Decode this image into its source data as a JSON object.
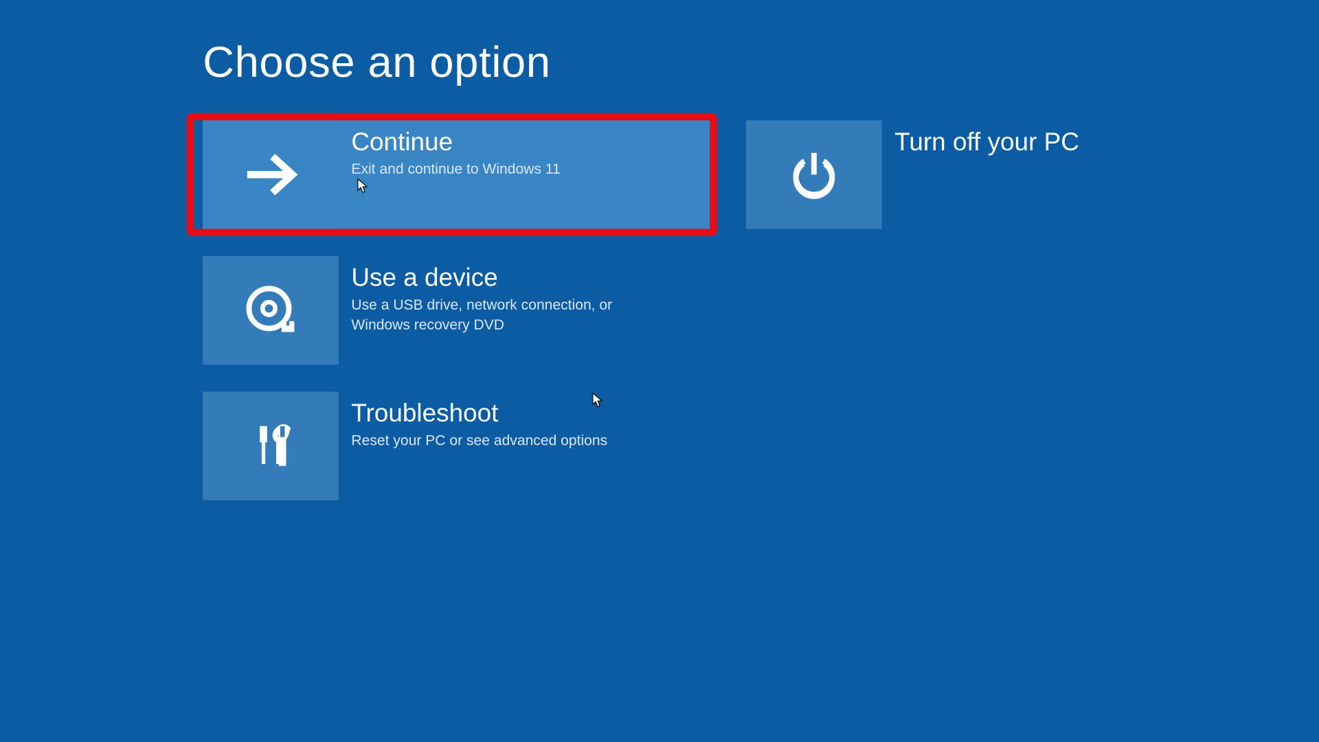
{
  "title": "Choose an option",
  "highlighted_option": "continue",
  "left_column": [
    {
      "id": "continue",
      "title": "Continue",
      "description": "Exit and continue to Windows 11",
      "icon": "arrow-right-icon",
      "selected": true
    },
    {
      "id": "use-a-device",
      "title": "Use a device",
      "description": "Use a USB drive, network connection, or Windows recovery DVD",
      "icon": "disc-icon",
      "selected": false
    },
    {
      "id": "troubleshoot",
      "title": "Troubleshoot",
      "description": "Reset your PC or see advanced options",
      "icon": "tools-icon",
      "selected": false
    }
  ],
  "right_column": [
    {
      "id": "turn-off",
      "title": "Turn off your PC",
      "description": "",
      "icon": "power-icon",
      "selected": false
    }
  ]
}
